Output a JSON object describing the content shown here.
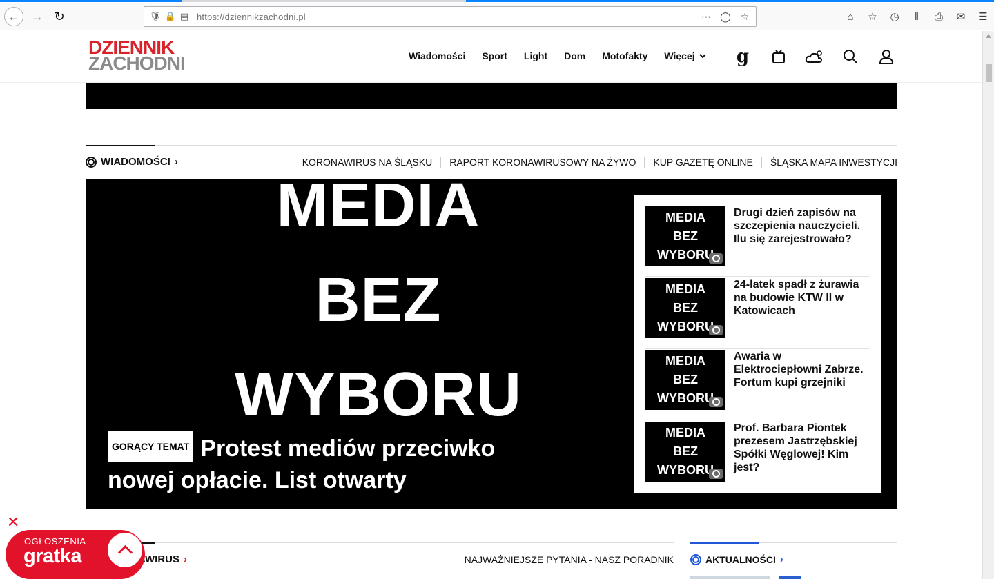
{
  "browser": {
    "url": "https://dziennikzachodni.pl"
  },
  "site": {
    "logo_line1": "DZIENNIK",
    "logo_line2": "ZACHODNI",
    "nav": [
      "Wiadomości",
      "Sport",
      "Light",
      "Dom",
      "Motofakty"
    ],
    "nav_more": "Więcej",
    "header_icons": [
      "g-logo-icon",
      "tv-icon",
      "weather-icon",
      "search-icon",
      "user-icon"
    ]
  },
  "section": {
    "title": "WIADOMOŚCI",
    "links": [
      "KORONAWIRUS NA ŚLĄSKU",
      "RAPORT KORONAWIRUSOWY NA ŻYWO",
      "KUP GAZETĘ ONLINE",
      "ŚLĄSKA MAPA INWESTYCJI"
    ]
  },
  "hero": {
    "image_words": [
      "MEDIA",
      "BEZ",
      "WYBORU"
    ],
    "tag": "GORĄCY TEMAT",
    "title": "Protest mediów przeciwko nowej opłacie. List otwarty"
  },
  "side_articles": [
    {
      "thumb_words": [
        "MEDIA",
        "BEZ",
        "WYBORU"
      ],
      "title": "Drugi dzień zapisów na szczepienia nauczycieli. Ilu się zarejestrowało?"
    },
    {
      "thumb_words": [
        "MEDIA",
        "BEZ",
        "WYBORU"
      ],
      "title": "24-latek spadł z żurawia na budowie KTW II w Katowicach"
    },
    {
      "thumb_words": [
        "MEDIA",
        "BEZ",
        "WYBORU"
      ],
      "title": "Awaria w Elektrociepłowni Zabrze. Fortum kupi grzejniki"
    },
    {
      "thumb_words": [
        "MEDIA",
        "BEZ",
        "WYBORU"
      ],
      "title": "Prof. Barbara Piontek prezesem Jastrzębskiej Spółki Węglowej! Kim jest?"
    }
  ],
  "lower": {
    "left_title": "KORONAWIRUS",
    "left_title_visible": "AWIRUS",
    "left_link": "NAJWAŻNIEJSZE PYTANIA - NASZ PORADNIK",
    "right_title": "AKTUALNOŚCI"
  },
  "gratka": {
    "label": "OGŁOSZENIA",
    "brand": "gratka"
  },
  "colors": {
    "brand_red": "#d8232a",
    "accent_blue": "#2057d8"
  }
}
